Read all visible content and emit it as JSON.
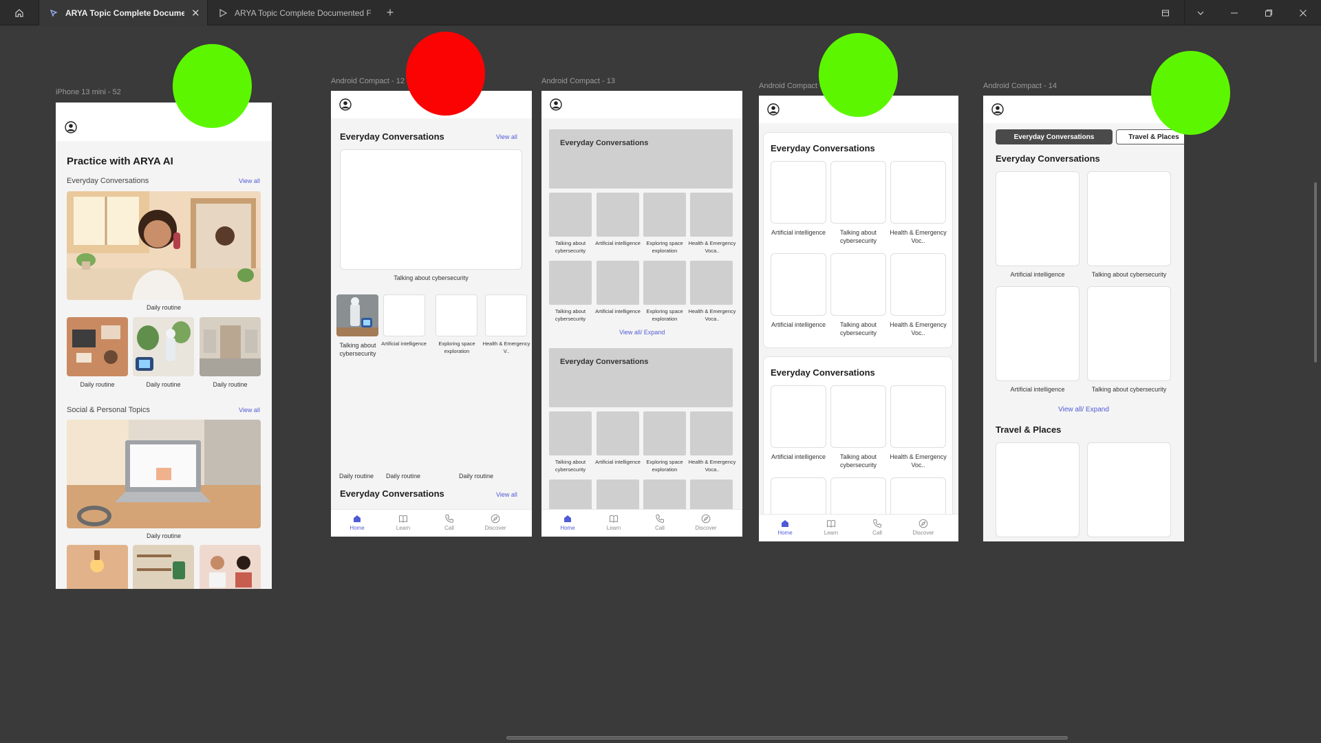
{
  "window": {
    "tabs": [
      {
        "title": "ARYA Topic Complete Document",
        "active": true
      },
      {
        "title": "ARYA Topic Complete Documented Fi",
        "active": false
      }
    ]
  },
  "frames": {
    "f52": {
      "label": "iPhone 13 mini - 52",
      "title": "Practice with ARYA AI",
      "s1_title": "Everyday Conversations",
      "s1_viewall": "View all",
      "hero_caption": "Daily routine",
      "s1_thumbs": [
        "Daily routine",
        "Daily routine",
        "Daily routine"
      ],
      "s2_title": "Social & Personal Topics",
      "s2_viewall": "View all",
      "s2_caption": "Daily routine"
    },
    "f12": {
      "label": "Android Compact - 12",
      "title": "Everyday Conversations",
      "viewall": "View all",
      "hero_caption": "Talking about cybersecurity",
      "thumbs": [
        "Talking about cybersecurity",
        "Artificial intelligence",
        "Exploring space exploration",
        "Health & Emergency V.."
      ],
      "routine_labels": [
        "Daily routine",
        "Daily routine",
        "Daily routine"
      ],
      "title2": "Everyday Conversations",
      "viewall2": "View all"
    },
    "f13": {
      "label": "Android Compact - 13",
      "banner1": "Everyday Conversations",
      "banner2": "Everyday Conversations",
      "captions": [
        "Talking about cybersecurity",
        "Artificial intelligence",
        "Exploring space exploration",
        "Health & Emergency Voca.."
      ],
      "expand": "View all/ Expand"
    },
    "f15": {
      "label": "Android Compact - 15",
      "title1": "Everyday Conversations",
      "title2": "Everyday Conversations",
      "captions": [
        "Artificial intelligence",
        "Talking about cybersecurity",
        "Health & Emergency Voc.."
      ]
    },
    "f14": {
      "label": "Android Compact - 14",
      "pills": [
        "Everyday Conversations",
        "Travel & Places"
      ],
      "title1": "Everyday Conversations",
      "captions": [
        "Artificial intelligence",
        "Talking about cybersecurity"
      ],
      "expand": "View all/ Expand",
      "title2": "Travel & Places"
    }
  },
  "nav": [
    "Home",
    "Learn",
    "Call",
    "Discover"
  ],
  "status_dots": [
    "green",
    "red",
    "green",
    "green",
    "green"
  ],
  "colors": {
    "green": "#5cf700",
    "red": "#fb0303",
    "accent": "#4f5bd5",
    "pill_dark": "#4a4a4a"
  }
}
